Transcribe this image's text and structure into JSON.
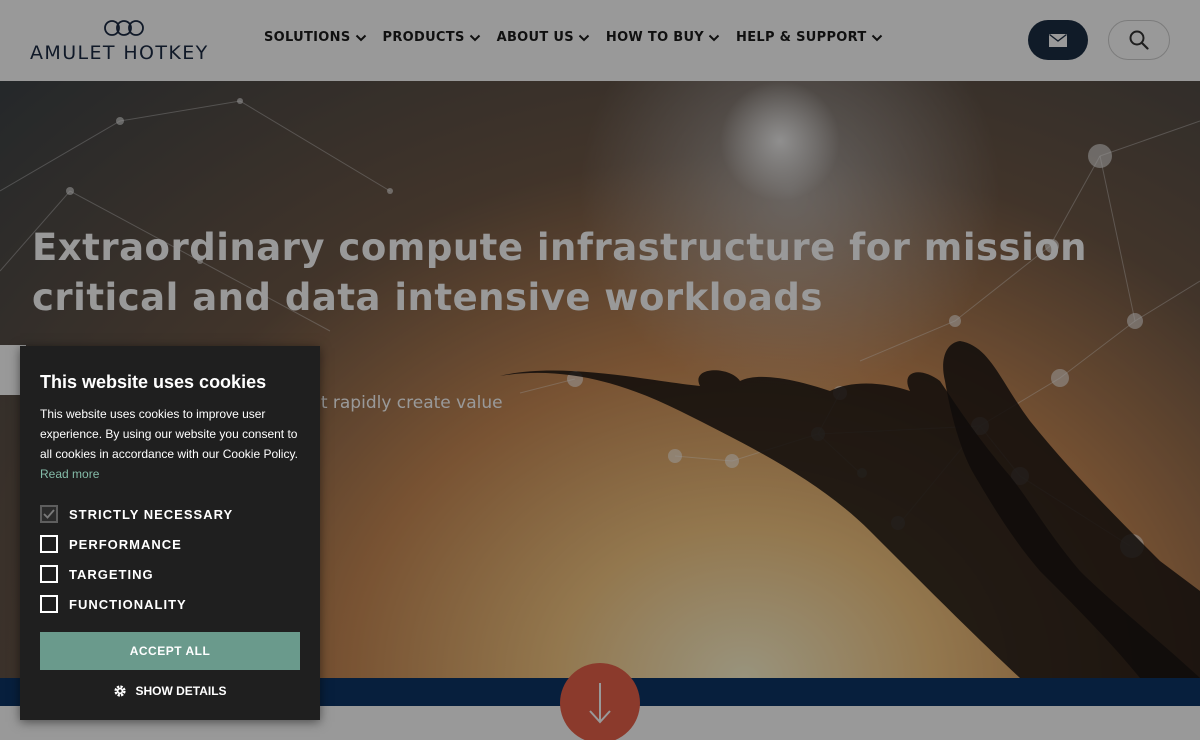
{
  "header": {
    "logo_text": "AMULET HOTKEY",
    "nav": [
      {
        "label": "SOLUTIONS"
      },
      {
        "label": "PRODUCTS"
      },
      {
        "label": "ABOUT US"
      },
      {
        "label": "HOW TO BUY"
      },
      {
        "label": "HELP & SUPPORT"
      }
    ],
    "mail_icon": "envelope-icon",
    "search_icon": "search-icon"
  },
  "hero": {
    "title": "Extraordinary compute infrastructure for mission critical and data intensive workloads",
    "subtitle": "ing edge technology solutions that rapidly create value"
  },
  "scroll_button_icon": "arrow-down-icon",
  "cookie": {
    "title": "This website uses cookies",
    "text": "This website uses cookies to improve user experience. By using our website you consent to all cookies in accordance with our Cookie Policy.",
    "read_more": "Read more",
    "options": [
      {
        "label": "STRICTLY NECESSARY",
        "checked": true
      },
      {
        "label": "PERFORMANCE",
        "checked": false
      },
      {
        "label": "TARGETING",
        "checked": false
      },
      {
        "label": "FUNCTIONALITY",
        "checked": false
      }
    ],
    "accept_label": "ACCEPT ALL",
    "details_label": "SHOW DETAILS"
  },
  "colors": {
    "header_bg": "#ffffff",
    "nav_text": "#1b1b1b",
    "brand_navy": "#1c2d44",
    "band": "#0c3466",
    "accent_orange": "#e8614a",
    "cookie_bg": "#1f1f1f",
    "accept_bg": "#6a9a8c",
    "link": "#84bba8"
  }
}
